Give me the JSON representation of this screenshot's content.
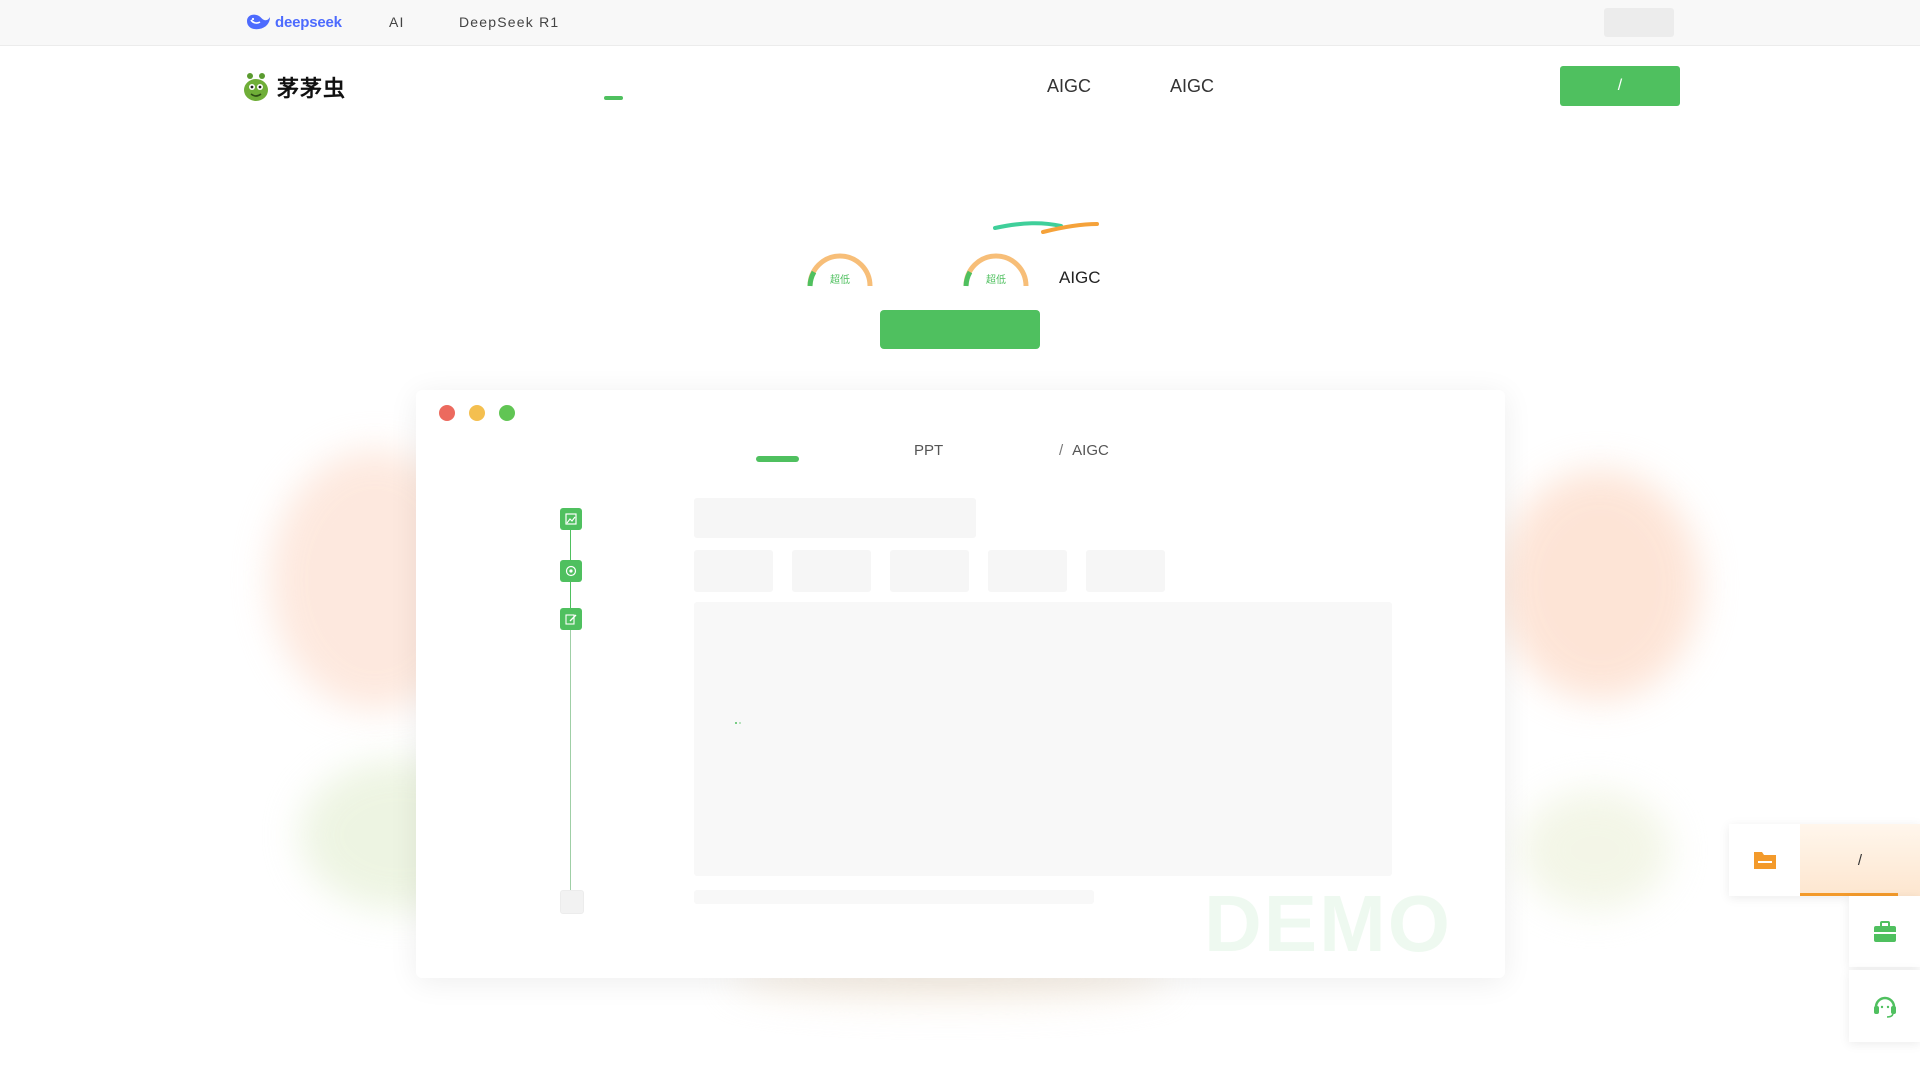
{
  "topbar": {
    "logo_text": "deepseek",
    "links": [
      "AI",
      "DeepSeek R1"
    ]
  },
  "nav": {
    "brand_text": "茅茅虫",
    "items": [
      "AIGC",
      "AIGC"
    ],
    "cta_label": "/"
  },
  "hero": {
    "gauge_label": "超低",
    "aigc_label": "AIGC",
    "cta_label": ""
  },
  "demo": {
    "tabs": [
      {
        "label": ""
      },
      {
        "label": "PPT"
      },
      {
        "label": "AIGC",
        "prefix": "/"
      }
    ],
    "watermark": "DEMO"
  },
  "float_panel": {
    "label": "/"
  },
  "colors": {
    "brand_green": "#4fc05f",
    "accent_orange": "#f39a2b",
    "deepseek_blue": "#4d6bfe"
  },
  "icons": [
    "whale-icon",
    "bug-mascot-icon",
    "image-step-icon",
    "target-step-icon",
    "edit-step-icon",
    "folder-icon",
    "briefcase-icon",
    "headset-icon"
  ]
}
